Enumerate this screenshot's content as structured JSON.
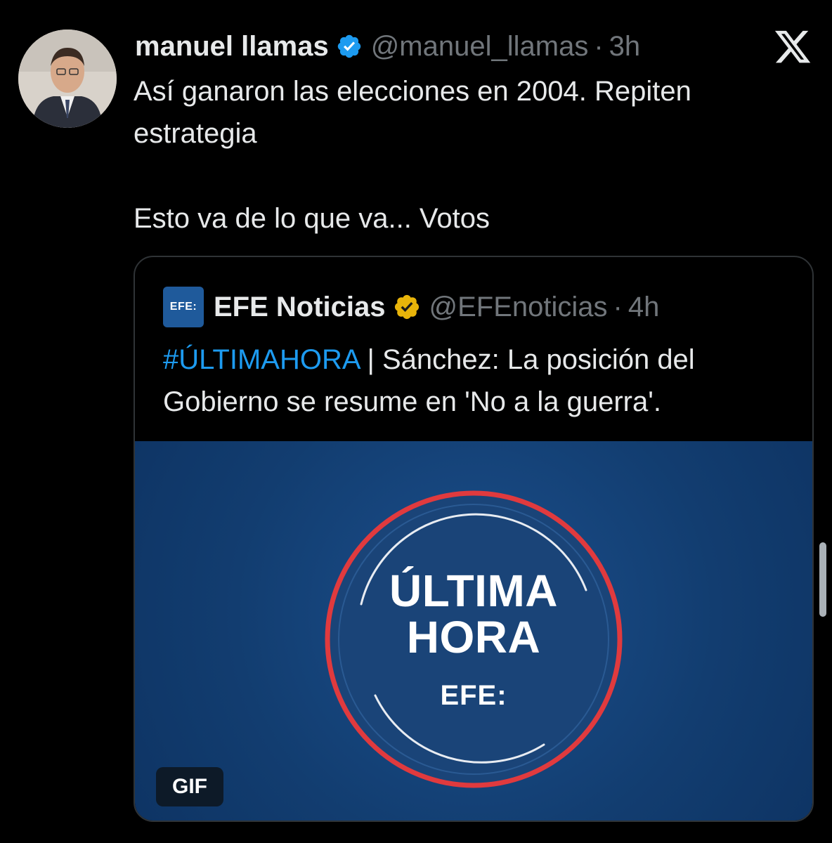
{
  "tweet": {
    "author_name": "manuel llamas",
    "handle": "@manuel_llamas",
    "separator": "·",
    "time": "3h",
    "text_line1": "Así ganaron las elecciones en 2004. Repiten estrategia",
    "text_line2": "Esto va de lo que va... Votos"
  },
  "quote": {
    "logo_text": "EFE:",
    "author_name": "EFE Noticias",
    "handle": "@EFEnoticias",
    "separator": "·",
    "time": "4h",
    "hashtag": "#ÚLTIMAHORA",
    "text": " | Sánchez: La posición del Gobierno se resume en 'No a la guerra'.",
    "media": {
      "line1": "ÚLTIMA",
      "line2": "HORA",
      "brand": "EFE:",
      "badge": "GIF"
    }
  },
  "icons": {
    "verified_badge_color": "#1d9bf0",
    "gold_badge_color": "#e8b40a",
    "x_logo": "x-logo-icon"
  },
  "colors": {
    "background": "#000000",
    "text": "#e7e9ea",
    "muted": "#71767b",
    "link": "#1d9bf0",
    "media_blue": "#123d70",
    "ring_red": "#e03a3e"
  }
}
